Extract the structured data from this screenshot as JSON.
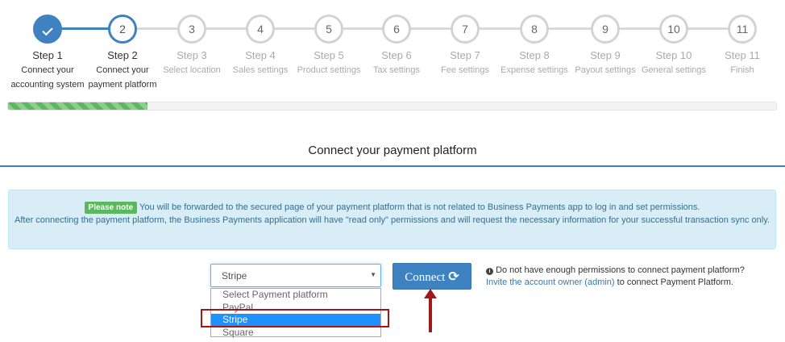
{
  "steps": [
    {
      "state": "done",
      "number": "",
      "label": "Step 1",
      "desc": "Connect your accounting system"
    },
    {
      "state": "current",
      "number": "2",
      "label": "Step 2",
      "desc": "Connect your payment platform"
    },
    {
      "state": "todo",
      "number": "3",
      "label": "Step 3",
      "desc": "Select location"
    },
    {
      "state": "todo",
      "number": "4",
      "label": "Step 4",
      "desc": "Sales settings"
    },
    {
      "state": "todo",
      "number": "5",
      "label": "Step 5",
      "desc": "Product settings"
    },
    {
      "state": "todo",
      "number": "6",
      "label": "Step 6",
      "desc": "Tax settings"
    },
    {
      "state": "todo",
      "number": "7",
      "label": "Step 7",
      "desc": "Fee settings"
    },
    {
      "state": "todo",
      "number": "8",
      "label": "Step 8",
      "desc": "Expense settings"
    },
    {
      "state": "todo",
      "number": "9",
      "label": "Step 9",
      "desc": "Payout settings"
    },
    {
      "state": "todo",
      "number": "10",
      "label": "Step 10",
      "desc": "General settings"
    },
    {
      "state": "todo",
      "number": "11",
      "label": "Step 11",
      "desc": "Finish"
    }
  ],
  "progress": {
    "percent": 18.2
  },
  "page_title": "Connect your payment platform",
  "info": {
    "badge": "Please note",
    "line1": "You will be forwarded to the secured page of your payment platform that is not related to Business Payments app to log in and set permissions.",
    "line2": "After connecting the payment platform, the Business Payments application will have \"read only\" permissions and will request the necessary information for your successful transaction sync only."
  },
  "payment_select": {
    "value": "Stripe",
    "options": [
      "Select Payment platform",
      "PayPal",
      "Stripe",
      "Square"
    ],
    "selected_index": 2
  },
  "connect_button": {
    "label": "Connect",
    "icon": "refresh-icon"
  },
  "permission_note": {
    "text": "Do not have enough permissions to connect payment platform?",
    "link": "Invite the account owner (admin)",
    "suffix": " to connect Payment Platform."
  },
  "colors": {
    "primary": "#3f82c1",
    "success": "#5cb85c",
    "annotation": "#a01818",
    "info_bg": "#d9edf7"
  }
}
